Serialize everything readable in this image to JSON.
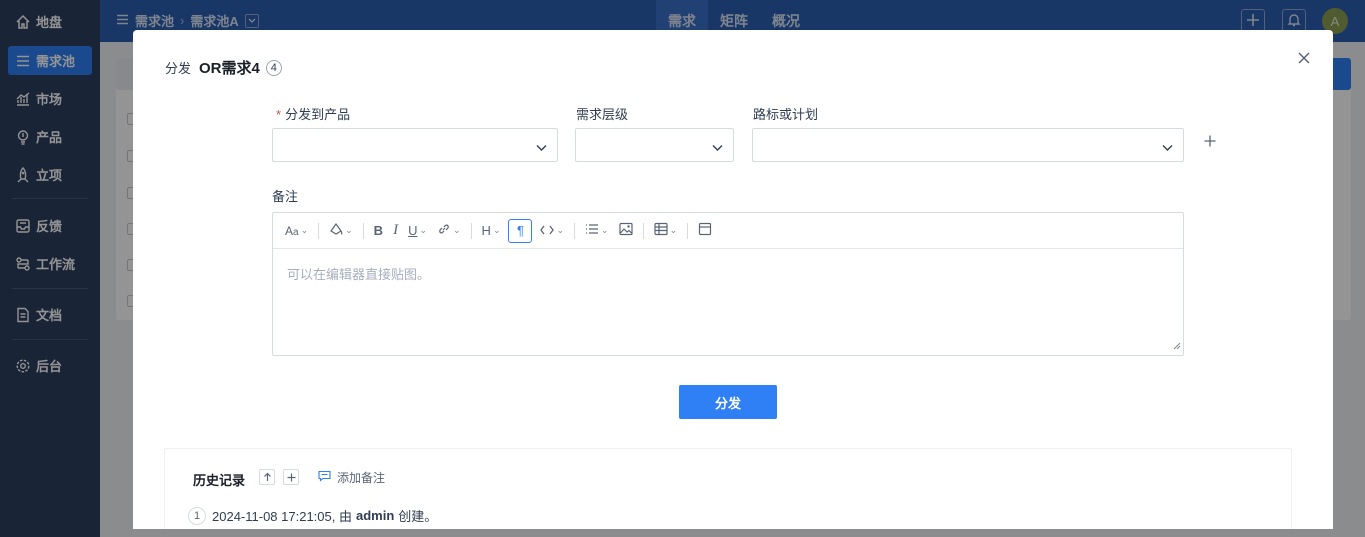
{
  "sidebar": {
    "items": [
      {
        "label": "地盘",
        "icon": "home-icon"
      },
      {
        "label": "需求池",
        "icon": "menu-icon",
        "active": true
      },
      {
        "label": "市场",
        "icon": "chart-icon"
      },
      {
        "label": "产品",
        "icon": "bulb-icon"
      },
      {
        "label": "立项",
        "icon": "rocket-icon"
      },
      {
        "label": "反馈",
        "icon": "inbox-icon"
      },
      {
        "label": "工作流",
        "icon": "workflow-icon"
      },
      {
        "label": "文档",
        "icon": "document-icon"
      },
      {
        "label": "后台",
        "icon": "gear-icon"
      }
    ]
  },
  "header": {
    "breadcrumb": [
      "需求池",
      "需求池A"
    ],
    "nav": [
      {
        "label": "需求",
        "active": true
      },
      {
        "label": "矩阵"
      },
      {
        "label": "概况"
      }
    ],
    "avatar": "A"
  },
  "modal": {
    "action_label": "分发",
    "title": "OR需求4",
    "badge": "4",
    "fields": {
      "product_label": "分发到产品",
      "level_label": "需求层级",
      "plan_label": "路标或计划",
      "note_label": "备注"
    },
    "editor": {
      "placeholder": "可以在编辑器直接贴图。"
    },
    "submit_label": "分发",
    "history": {
      "title": "历史记录",
      "add_note": "添加备注",
      "entries": [
        {
          "num": "1",
          "prefix": "2024-11-08 17:21:05, 由",
          "user": "admin",
          "suffix": "创建。"
        }
      ]
    }
  },
  "colors": {
    "sidebar_bg": "#2c3e5d",
    "header_bg": "#2a5db0",
    "primary": "#2f7ff5"
  }
}
